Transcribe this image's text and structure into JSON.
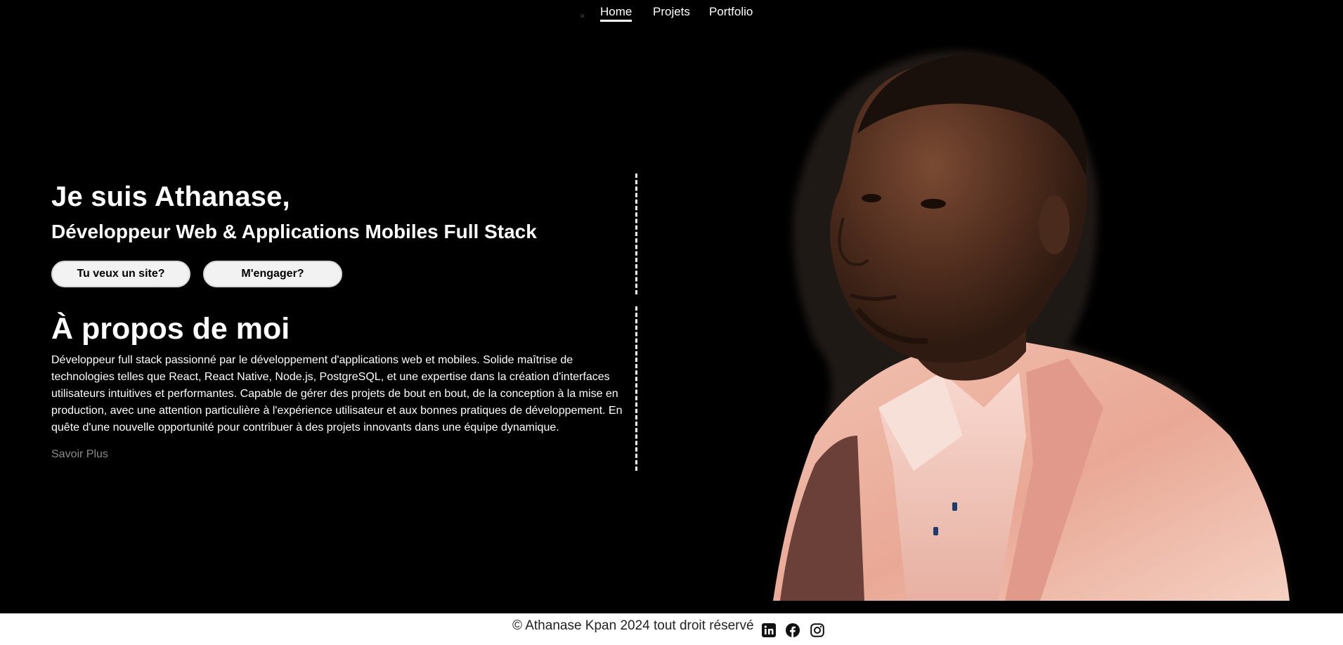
{
  "nav": {
    "close_symbol": "×",
    "items": [
      {
        "label": "Home",
        "active": true
      },
      {
        "label": "Projets",
        "active": false
      },
      {
        "label": "Portfolio",
        "active": false
      }
    ]
  },
  "hero": {
    "title": "Je suis Athanase,",
    "subtitle": "Développeur Web & Applications Mobiles Full Stack",
    "buttons": [
      {
        "label": "Tu veux un site?"
      },
      {
        "label": "M'engager?"
      }
    ]
  },
  "about": {
    "title": "À propos de moi",
    "text": "Développeur full stack passionné par le développement d'applications web et mobiles. Solide maîtrise de technologies telles que React, React Native, Node.js, PostgreSQL, et une expertise dans la création d'interfaces utilisateurs intuitives et performantes. Capable de gérer des projets de bout en bout, de la conception à la mise en production, avec une attention particulière à l'expérience utilisateur et aux bonnes pratiques de développement. En quête d'une nouvelle opportunité pour contribuer à des projets innovants dans une équipe dynamique.",
    "more_label": "Savoir Plus"
  },
  "footer": {
    "copyright": "© Athanase Kpan 2024 tout droit réservé",
    "social": [
      {
        "icon": "linkedin-icon"
      },
      {
        "icon": "facebook-icon"
      },
      {
        "icon": "instagram-icon"
      }
    ]
  },
  "colors": {
    "background": "#000000",
    "text": "#ffffff",
    "button_bg": "#f2f2f2",
    "footer_bg": "#ffffff",
    "muted_link": "#8a8a8a"
  }
}
